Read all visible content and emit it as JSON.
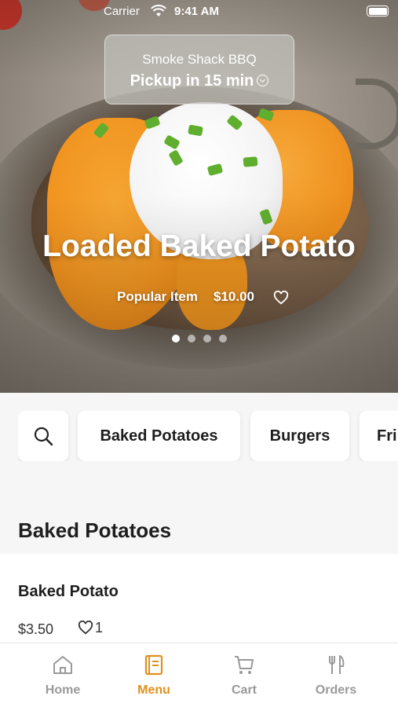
{
  "status_bar": {
    "carrier": "Carrier",
    "time": "9:41 AM"
  },
  "restaurant": {
    "name": "Smoke Shack BBQ",
    "pickup": "Pickup in 15 min"
  },
  "hero": {
    "title": "Loaded Baked Potato",
    "tag": "Popular Item",
    "price": "$10.00",
    "page_count": 4,
    "active_page": 1
  },
  "categories": [
    {
      "label": "Baked Potatoes"
    },
    {
      "label": "Burgers"
    },
    {
      "label": "Fri"
    }
  ],
  "section": {
    "title": "Baked Potatoes"
  },
  "items": [
    {
      "name": "Baked Potato",
      "price": "$3.50",
      "likes": "1"
    }
  ],
  "tabs": [
    {
      "label": "Home",
      "icon": "home-icon"
    },
    {
      "label": "Menu",
      "icon": "menu-book-icon"
    },
    {
      "label": "Cart",
      "icon": "cart-icon"
    },
    {
      "label": "Orders",
      "icon": "fork-knife-icon"
    }
  ],
  "colors": {
    "accent": "#e0901d",
    "inactive_tab": "#999999"
  }
}
